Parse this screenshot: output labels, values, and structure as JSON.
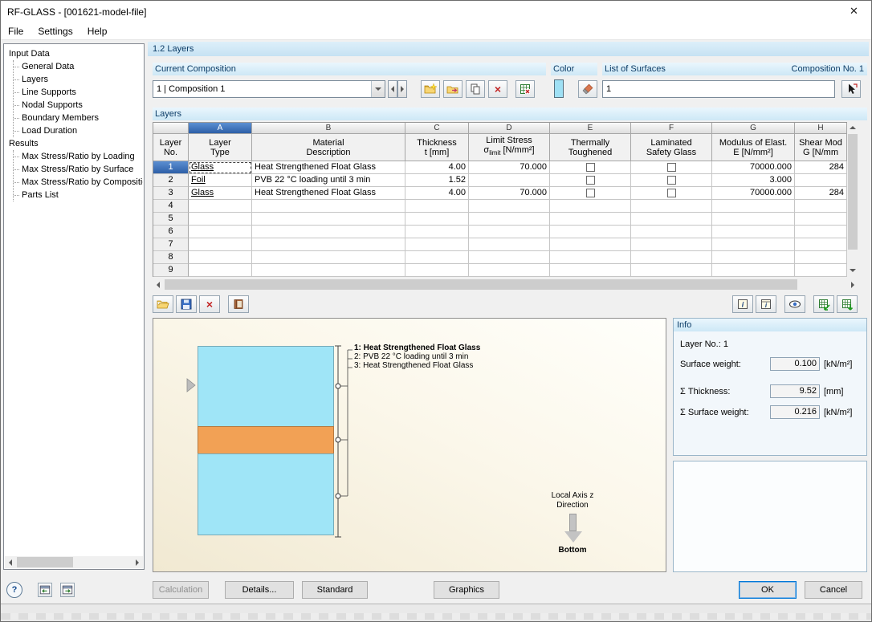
{
  "window": {
    "title": "RF-GLASS - [001621-model-file]"
  },
  "menubar": {
    "items": [
      "File",
      "Settings",
      "Help"
    ]
  },
  "sidebar": {
    "input_data": {
      "label": "Input Data",
      "items": [
        "General Data",
        "Layers",
        "Line Supports",
        "Nodal Supports",
        "Boundary Members",
        "Load Duration"
      ]
    },
    "results": {
      "label": "Results",
      "items": [
        "Max Stress/Ratio by Loading",
        "Max Stress/Ratio by Surface",
        "Max Stress/Ratio by Composition",
        "Parts List"
      ]
    }
  },
  "main": {
    "section_title": "1.2 Layers",
    "composition": {
      "group_label": "Current Composition",
      "dropdown_value": "1 | Composition 1"
    },
    "color_group": {
      "label": "Color",
      "swatch_color": "#9fe0f4"
    },
    "surfaces_group": {
      "label": "List of Surfaces",
      "right_label": "Composition No. 1",
      "value": "1"
    }
  },
  "table": {
    "group_label": "Layers",
    "corner": {
      "line1": "Layer",
      "line2": "No."
    },
    "columns": [
      {
        "letter": "A",
        "line1": "Layer",
        "line2": "Type"
      },
      {
        "letter": "B",
        "line1": "Material",
        "line2": "Description"
      },
      {
        "letter": "C",
        "line1": "Thickness",
        "line2": "t [mm]"
      },
      {
        "letter": "D",
        "line1": "Limit Stress",
        "sigma": "σ",
        "sub": "limit",
        "unit": "[N/mm²]"
      },
      {
        "letter": "E",
        "line1": "Thermally",
        "line2": "Toughened"
      },
      {
        "letter": "F",
        "line1": "Laminated",
        "line2": "Safety Glass"
      },
      {
        "letter": "G",
        "line1": "Modulus of Elast.",
        "line2": "E [N/mm²]"
      },
      {
        "letter": "H",
        "line1": "Shear Mod",
        "line2": "G [N/mm"
      }
    ],
    "rows": [
      {
        "no": "1",
        "type": "Glass",
        "material": "Heat Strengthened Float Glass",
        "thickness": "4.00",
        "limit_stress": "70.000",
        "thermally_toughened": false,
        "laminated_safety": false,
        "modulus": "70000.000",
        "shear": "284"
      },
      {
        "no": "2",
        "type": "Foil",
        "material": "PVB 22 °C loading until 3 min",
        "thickness": "1.52",
        "limit_stress": "",
        "thermally_toughened": false,
        "laminated_safety": false,
        "modulus": "3.000",
        "shear": ""
      },
      {
        "no": "3",
        "type": "Glass",
        "material": "Heat Strengthened Float Glass",
        "thickness": "4.00",
        "limit_stress": "70.000",
        "thermally_toughened": false,
        "laminated_safety": false,
        "modulus": "70000.000",
        "shear": "284"
      },
      {
        "no": "4"
      },
      {
        "no": "5"
      },
      {
        "no": "6"
      },
      {
        "no": "7"
      },
      {
        "no": "8"
      },
      {
        "no": "9"
      }
    ]
  },
  "diagram": {
    "glass_color": "#9fe5f7",
    "foil_color": "#f2a155",
    "legend": [
      "1: Heat Strengthened Float Glass",
      "2: PVB 22 °C loading until 3 min",
      "3: Heat Strengthened Float Glass"
    ],
    "local_axis_line1": "Local Axis z",
    "local_axis_line2": "Direction",
    "bottom_label": "Bottom"
  },
  "info": {
    "label": "Info",
    "layer_no_label": "Layer No.:",
    "layer_no_value": "1",
    "rows": [
      {
        "label": "Surface weight:",
        "value": "0.100",
        "unit": "[kN/m²]"
      },
      {
        "label": "Σ Thickness:",
        "value": "9.52",
        "unit": "[mm]"
      },
      {
        "label": "Σ Surface weight:",
        "value": "0.216",
        "unit": "[kN/m²]"
      }
    ]
  },
  "footer": {
    "calculation": "Calculation",
    "details": "Details...",
    "standard": "Standard",
    "graphics": "Graphics",
    "ok": "OK",
    "cancel": "Cancel"
  }
}
